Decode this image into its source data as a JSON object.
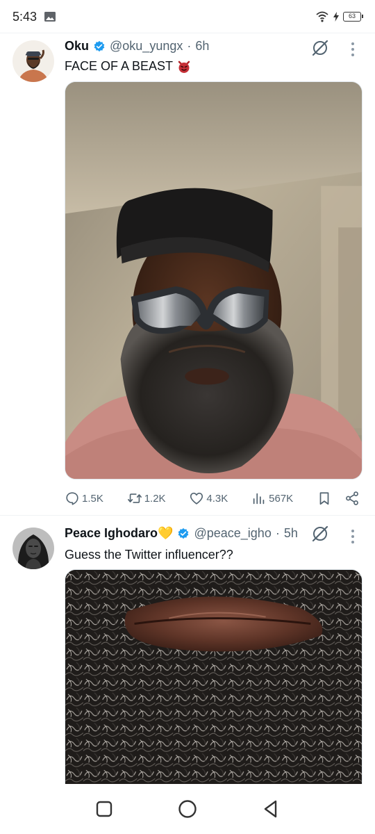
{
  "status_bar": {
    "time": "5:43",
    "battery": "63"
  },
  "tweets": [
    {
      "display_name": "Oku",
      "handle": "@oku_yungx",
      "separator": "·",
      "time_ago": "6h",
      "text": "FACE OF A BEAST",
      "actions": {
        "replies": "1.5K",
        "reposts": "1.2K",
        "likes": "4.3K",
        "views": "567K"
      }
    },
    {
      "display_name": "Peace Ighodaro💛",
      "handle": "@peace_igho",
      "separator": "·",
      "time_ago": "5h",
      "text": "Guess the Twitter influencer??"
    }
  ],
  "colors": {
    "verified_blue": "#1d9bf0",
    "secondary_text": "#536471",
    "primary_text": "#0f1419"
  },
  "icons": [
    "gallery-icon",
    "wifi-icon",
    "charging-icon",
    "battery-icon",
    "verified-icon",
    "grok-icon",
    "more-icon",
    "reply-icon",
    "repost-icon",
    "like-icon",
    "views-icon",
    "bookmark-icon",
    "share-icon",
    "recents-icon",
    "home-icon",
    "back-icon"
  ]
}
